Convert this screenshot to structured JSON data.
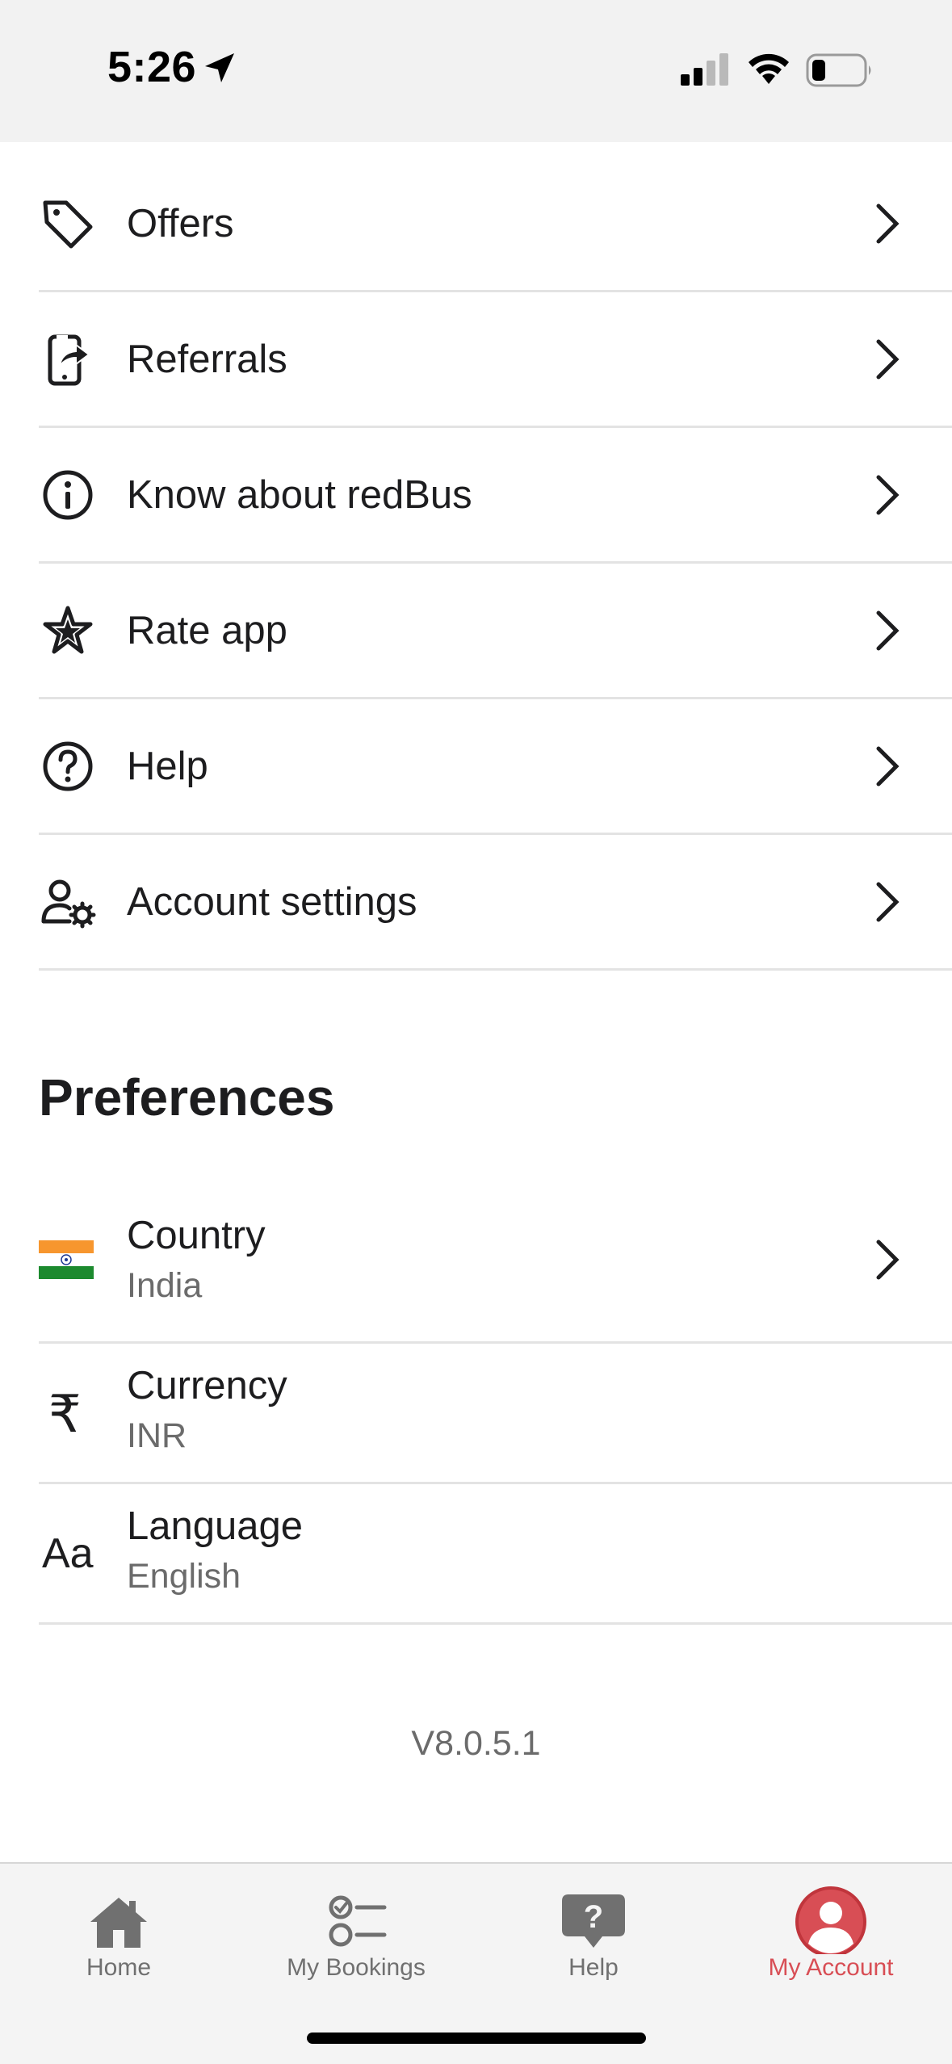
{
  "status_bar": {
    "time": "5:26"
  },
  "menu": [
    {
      "label": "Offers",
      "icon": "tag-icon"
    },
    {
      "label": "Referrals",
      "icon": "referral-phone-icon"
    },
    {
      "label": "Know about redBus",
      "icon": "info-icon"
    },
    {
      "label": "Rate app",
      "icon": "star-icon"
    },
    {
      "label": "Help",
      "icon": "help-circle-icon"
    },
    {
      "label": "Account settings",
      "icon": "user-settings-icon"
    }
  ],
  "preferences": {
    "title": "Preferences",
    "country": {
      "label": "Country",
      "value": "India",
      "icon": "india-flag-icon"
    },
    "currency": {
      "label": "Currency",
      "value": "INR",
      "icon": "rupee-icon",
      "symbol": "₹"
    },
    "language": {
      "label": "Language",
      "value": "English",
      "icon": "language-icon",
      "symbol": "Aa"
    }
  },
  "version": "V8.0.5.1",
  "tab_bar": {
    "tabs": [
      {
        "label": "Home",
        "icon": "home-icon"
      },
      {
        "label": "My Bookings",
        "icon": "bookings-icon"
      },
      {
        "label": "Help",
        "icon": "help-bubble-icon"
      },
      {
        "label": "My Account",
        "icon": "account-icon",
        "active": true
      }
    ]
  },
  "colors": {
    "accent": "#d84e55",
    "divider": "#e3e3e3",
    "tab_bar_bg": "#f4f4f4"
  }
}
